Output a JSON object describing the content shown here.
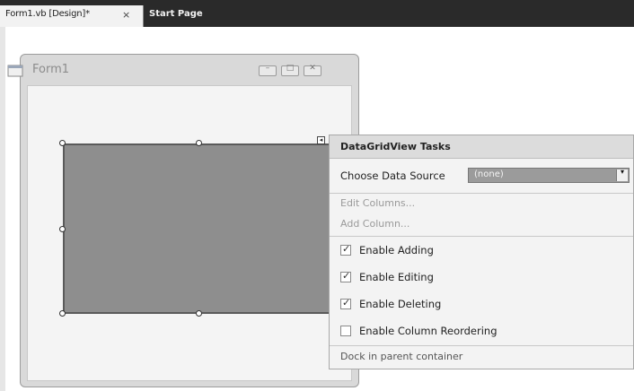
{
  "tabs": {
    "active_label": "Form1.vb [Design]*",
    "close_glyph": "×",
    "inactive_label": "Start Page"
  },
  "form": {
    "title": "Form1",
    "icon": "form-window-icon",
    "minimize_glyph": "–",
    "maximize_glyph": "□",
    "close_glyph": "✕"
  },
  "smart_tag_glyph": "◂",
  "tasks_panel": {
    "title": "DataGridView Tasks",
    "choose_data_source_label": "Choose Data Source",
    "data_source_value": "(none)",
    "dropdown_glyph": "▾",
    "links": [
      "Edit Columns...",
      "Add Column..."
    ],
    "checkboxes": [
      {
        "label": "Enable Adding",
        "checked": true
      },
      {
        "label": "Enable Editing",
        "checked": true
      },
      {
        "label": "Enable Deleting",
        "checked": true
      },
      {
        "label": "Enable Column Reordering",
        "checked": false
      }
    ],
    "check_glyph": "✓",
    "dock_link": "Dock in parent container"
  }
}
